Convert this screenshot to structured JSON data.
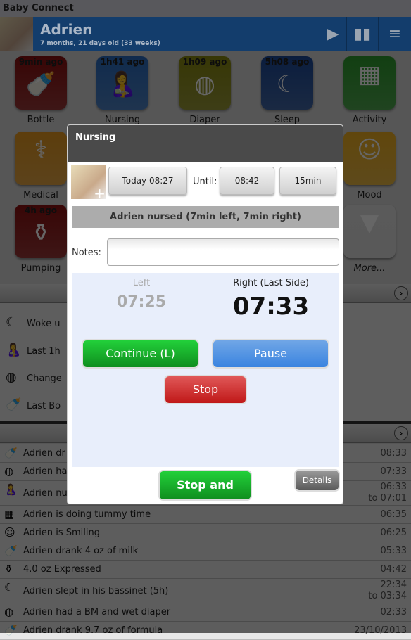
{
  "app": {
    "title": "Baby Connect"
  },
  "child": {
    "name": "Adrien",
    "age": "7 months, 21 days old (33 weeks)"
  },
  "header_icons": [
    "play-arrow-icon",
    "chart-icon",
    "menu-icon"
  ],
  "tiles": [
    {
      "label": "Bottle",
      "ago": "9min ago",
      "color": "#8b1010",
      "glyph": "🍼"
    },
    {
      "label": "Nursing",
      "ago": "1h41 ago",
      "color": "#2a6cc0",
      "glyph": "🤱"
    },
    {
      "label": "Diaper",
      "ago": "1h09 ago",
      "color": "#8a8a10",
      "glyph": "◍"
    },
    {
      "label": "Sleep",
      "ago": "5h08 ago",
      "color": "#1c4a9a",
      "glyph": "☾"
    },
    {
      "label": "Activity",
      "ago": "",
      "color": "#2e9e2e",
      "glyph": "▦"
    },
    {
      "label": "Medical",
      "ago": "",
      "color": "#e89a20",
      "glyph": "⚕"
    },
    {
      "label": "Mood",
      "ago": "",
      "color": "#f0b020",
      "glyph": "☺"
    },
    {
      "label": "Pumping",
      "ago": "4h ago",
      "color": "#8b1010",
      "glyph": "⚱"
    },
    {
      "label": "More...",
      "ago": "",
      "color": "#e0e0e0",
      "glyph": "▼"
    }
  ],
  "summary": [
    "Woke u",
    "Last 1h",
    "Change",
    "Last Bo"
  ],
  "activity_list": [
    {
      "text": "Adrien dr",
      "time": "08:33",
      "icon": "🍼"
    },
    {
      "text": "Adrien ha",
      "time": "07:33",
      "icon": "◍"
    },
    {
      "text": "Adrien nu",
      "time": "06:33",
      "time2": "to 07:01",
      "icon": "🤱"
    },
    {
      "text": "Adrien is doing tummy time",
      "time": "06:35",
      "icon": "▦"
    },
    {
      "text": "Adrien is Smiling",
      "time": "06:25",
      "icon": "☺"
    },
    {
      "text": "Adrien drank 4 oz of milk",
      "time": "05:33",
      "icon": "🍼"
    },
    {
      "text": "4.0 oz Expressed",
      "time": "04:42",
      "icon": "⚱"
    },
    {
      "text": "Adrien slept in his bassinet (5h)",
      "time": "22:34",
      "time2": "to 03:34",
      "icon": "☾"
    },
    {
      "text": "Adrien had a BM and wet diaper",
      "time": "02:33",
      "icon": "◍"
    },
    {
      "text": "Adrien drank 9.7 oz of formula",
      "time": "23/10/2013",
      "icon": "🍼"
    }
  ],
  "dialog": {
    "title": "Nursing",
    "start": "Today 08:27",
    "until_label": "Until:",
    "end": "08:42",
    "duration": "15min",
    "summary": "Adrien nursed (7min left, 7min right)",
    "notes_label": "Notes:",
    "notes_value": "",
    "left_label": "Left",
    "left_time": "07:25",
    "right_label": "Right (Last Side)",
    "right_time": "07:33",
    "continue_label": "Continue (L)",
    "pause_label": "Pause",
    "stop_label": "Stop",
    "save_label": "Stop and Save",
    "details_label": "Details"
  }
}
